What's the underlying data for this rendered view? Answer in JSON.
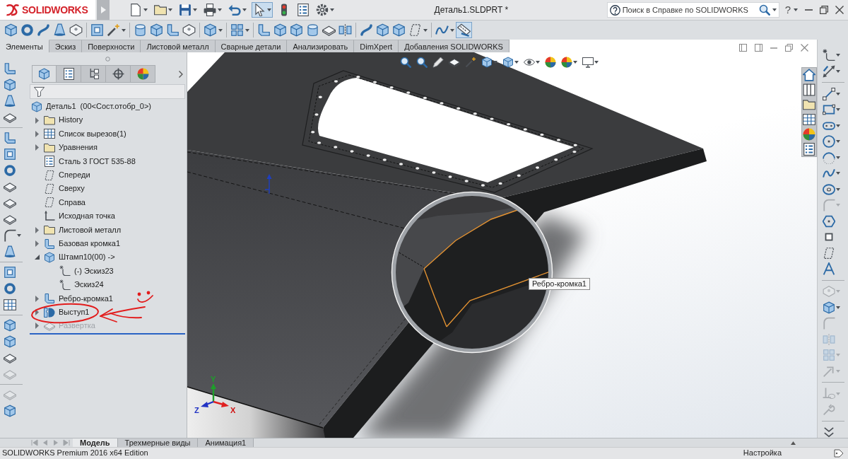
{
  "title_bar": {
    "logo": "SOLIDWORKS",
    "document": "Деталь1.SLDPRT *",
    "search": {
      "placeholder": "Поиск в Справке по SOLIDWORKS"
    },
    "help": "?"
  },
  "quick_toolbar": [
    {
      "kind": "page",
      "menu": true,
      "pressed": false
    },
    {
      "kind": "folder",
      "menu": true,
      "pressed": false
    },
    {
      "kind": "disk",
      "menu": true,
      "pressed": false
    },
    {
      "kind": "printer",
      "menu": true,
      "pressed": false
    },
    {
      "kind": "undo",
      "menu": true,
      "pressed": false
    },
    {
      "kind": "pointer",
      "menu": true,
      "pressed": true
    },
    {
      "kind": "traffic-light",
      "menu": false,
      "pressed": false
    },
    {
      "kind": "list",
      "menu": false,
      "pressed": false
    },
    {
      "kind": "gear",
      "menu": true,
      "pressed": false
    }
  ],
  "command_toolbar": [
    [
      {
        "kind": "cube",
        "menu": false,
        "pressed": false
      },
      {
        "kind": "ring",
        "menu": false,
        "pressed": false
      },
      {
        "kind": "s-curve",
        "menu": false,
        "pressed": false
      },
      {
        "kind": "cone",
        "menu": false,
        "pressed": false
      },
      {
        "kind": "block",
        "menu": false,
        "pressed": false
      }
    ],
    [
      {
        "kind": "frame",
        "menu": false,
        "pressed": false
      },
      {
        "kind": "wand",
        "menu": true,
        "pressed": false
      }
    ],
    [
      {
        "kind": "cylinder",
        "menu": false,
        "pressed": false
      },
      {
        "kind": "cube",
        "menu": false,
        "pressed": false
      },
      {
        "kind": "bracket",
        "menu": false,
        "pressed": false
      },
      {
        "kind": "block",
        "menu": false,
        "pressed": false
      }
    ],
    [
      {
        "kind": "cube",
        "menu": true,
        "pressed": false
      }
    ],
    [
      {
        "kind": "pattern",
        "menu": true,
        "pressed": false
      }
    ],
    [
      {
        "kind": "bracket",
        "menu": false,
        "pressed": false
      },
      {
        "kind": "cube",
        "menu": false,
        "pressed": false
      },
      {
        "kind": "cube",
        "menu": false,
        "pressed": false
      },
      {
        "kind": "cylinder",
        "menu": false,
        "pressed": false
      },
      {
        "kind": "plate",
        "menu": false,
        "pressed": false
      },
      {
        "kind": "mirror",
        "menu": false,
        "pressed": false
      }
    ],
    [
      {
        "kind": "s-curve",
        "menu": false,
        "pressed": false
      },
      {
        "kind": "cube",
        "menu": false,
        "pressed": false
      },
      {
        "kind": "cube",
        "menu": false,
        "pressed": false
      },
      {
        "kind": "plane",
        "menu": true,
        "pressed": false
      }
    ],
    [
      {
        "kind": "spline",
        "menu": true,
        "pressed": false
      },
      {
        "kind": "ruler",
        "menu": false,
        "pressed": true
      }
    ]
  ],
  "command_tabs": [
    {
      "label": "Элементы",
      "selected": true
    },
    {
      "label": "Эскиз",
      "selected": false
    },
    {
      "label": "Поверхности",
      "selected": false
    },
    {
      "label": "Листовой металл",
      "selected": false
    },
    {
      "label": "Сварные детали",
      "selected": false
    },
    {
      "label": "Анализировать",
      "selected": false
    },
    {
      "label": "DimXpert",
      "selected": false
    },
    {
      "label": "Добавления SOLIDWORKS",
      "selected": false
    }
  ],
  "feature_toolbar": [
    [
      {
        "kind": "bracket",
        "menu": false,
        "disabled": false
      },
      {
        "kind": "cube",
        "menu": false,
        "disabled": false
      },
      {
        "kind": "cone",
        "menu": false,
        "disabled": false
      },
      {
        "kind": "plate",
        "menu": false,
        "disabled": false
      }
    ],
    [
      {
        "kind": "bracket",
        "menu": false,
        "disabled": false
      },
      {
        "kind": "frame",
        "menu": false,
        "disabled": false
      },
      {
        "kind": "ring",
        "menu": false,
        "disabled": false
      },
      {
        "kind": "plate",
        "menu": false,
        "disabled": false
      },
      {
        "kind": "plate",
        "menu": false,
        "disabled": false
      },
      {
        "kind": "plate",
        "menu": false,
        "disabled": false
      },
      {
        "kind": "corner",
        "menu": true,
        "disabled": false
      },
      {
        "kind": "cone",
        "menu": false,
        "disabled": false
      }
    ],
    [
      {
        "kind": "frame",
        "menu": false,
        "disabled": false
      },
      {
        "kind": "ring",
        "menu": false,
        "disabled": false
      },
      {
        "kind": "table",
        "menu": false,
        "disabled": false
      }
    ],
    [
      {
        "kind": "cube",
        "menu": false,
        "disabled": false
      },
      {
        "kind": "cube",
        "menu": false,
        "disabled": false
      },
      {
        "kind": "plate",
        "menu": false,
        "disabled": false
      },
      {
        "kind": "plate",
        "menu": false,
        "disabled": true
      }
    ],
    [
      {
        "kind": "plate",
        "menu": false,
        "disabled": true
      },
      {
        "kind": "cube",
        "menu": false,
        "disabled": false
      }
    ]
  ],
  "panel": {
    "tabs": [
      {
        "kind": "cube",
        "selected": true
      },
      {
        "kind": "list",
        "selected": false
      },
      {
        "kind": "tree",
        "selected": false
      },
      {
        "kind": "crosshair",
        "selected": false
      },
      {
        "kind": "color-ball",
        "selected": false
      }
    ]
  },
  "tree": {
    "label": "Деталь1  (00<Сост.отобр_0>)",
    "kind": "cube",
    "disabled": false,
    "children": [
      {
        "label": "History",
        "kind": "folder",
        "expandable": true,
        "expanded": false,
        "disabled": false
      },
      {
        "label": "Список вырезов(1)",
        "kind": "table",
        "expandable": true,
        "expanded": false,
        "disabled": false
      },
      {
        "label": "Уравнения",
        "kind": "folder",
        "expandable": true,
        "expanded": false,
        "disabled": false
      },
      {
        "label": "Сталь 3 ГОСТ 535-88",
        "kind": "list",
        "expandable": false,
        "expanded": false,
        "disabled": false
      },
      {
        "label": "Спереди",
        "kind": "plane",
        "expandable": false,
        "expanded": false,
        "disabled": false
      },
      {
        "label": "Сверху",
        "kind": "plane",
        "expandable": false,
        "expanded": false,
        "disabled": false
      },
      {
        "label": "Справа",
        "kind": "plane",
        "expandable": false,
        "expanded": false,
        "disabled": false
      },
      {
        "label": "Исходная точка",
        "kind": "axis",
        "expandable": false,
        "expanded": false,
        "disabled": false
      },
      {
        "label": "Листовой металл",
        "kind": "folder",
        "expandable": true,
        "expanded": false,
        "disabled": false
      },
      {
        "label": "Базовая кромка1",
        "kind": "bracket",
        "expandable": true,
        "expanded": false,
        "disabled": false
      },
      {
        "label": "Штамп10(00) ->",
        "kind": "cube",
        "expandable": true,
        "expanded": true,
        "disabled": false,
        "children": [
          {
            "label": "(-) Эскиз23",
            "kind": "sketch",
            "expandable": false,
            "expanded": false,
            "disabled": false
          },
          {
            "label": "Эскиз24",
            "kind": "sketch",
            "expandable": false,
            "expanded": false,
            "disabled": false
          }
        ]
      },
      {
        "label": "Ребро-кромка1",
        "kind": "bracket",
        "expandable": true,
        "expanded": false,
        "disabled": false
      },
      {
        "label": "Выступ1",
        "kind": "d-shape",
        "expandable": true,
        "expanded": false,
        "disabled": false
      },
      {
        "label": "Развертка",
        "kind": "plate",
        "expandable": true,
        "expanded": false,
        "disabled": true
      }
    ]
  },
  "viewport": {
    "heads_up_toolbar": [
      {
        "kind": "magnifier",
        "menu": false
      },
      {
        "kind": "magnifier",
        "menu": false
      },
      {
        "kind": "pencil",
        "menu": false
      },
      {
        "kind": "plate",
        "menu": false
      },
      {
        "kind": "wand",
        "menu": false
      },
      {
        "kind": "cube",
        "menu": true
      },
      {
        "kind": "cube",
        "menu": true
      },
      {
        "kind": "eye",
        "menu": true
      },
      {
        "kind": "color-ball",
        "menu": false
      },
      {
        "kind": "color-ball",
        "menu": true
      },
      {
        "kind": "monitor",
        "menu": true
      }
    ],
    "view_pane": [
      {
        "kind": "home"
      },
      {
        "kind": "books"
      },
      {
        "kind": "folder"
      },
      {
        "kind": "table"
      },
      {
        "kind": "color-ball"
      },
      {
        "kind": "list"
      }
    ],
    "tooltip": "Ребро-кромка1",
    "triad": {
      "x": "X",
      "y": "Y",
      "z": "Z"
    }
  },
  "sketch_toolbar": [
    [
      {
        "kind": "sketch",
        "menu": true,
        "disabled": false
      },
      {
        "kind": "dimension",
        "menu": true,
        "disabled": false
      }
    ],
    [
      {
        "kind": "line",
        "menu": true,
        "disabled": false
      },
      {
        "kind": "rectangle",
        "menu": true,
        "disabled": false
      },
      {
        "kind": "slot",
        "menu": true,
        "disabled": false
      },
      {
        "kind": "circle",
        "menu": true,
        "disabled": false
      },
      {
        "kind": "arc",
        "menu": true,
        "disabled": false
      },
      {
        "kind": "spline",
        "menu": true,
        "disabled": false
      },
      {
        "kind": "ellipse",
        "menu": true,
        "disabled": false
      },
      {
        "kind": "corner",
        "menu": true,
        "disabled": true
      },
      {
        "kind": "polygon",
        "menu": false,
        "disabled": false
      },
      {
        "kind": "point",
        "menu": false,
        "disabled": false
      },
      {
        "kind": "plane",
        "menu": false,
        "disabled": false
      },
      {
        "kind": "letter-a",
        "menu": false,
        "disabled": false
      }
    ],
    [
      {
        "kind": "block",
        "menu": true,
        "disabled": true
      },
      {
        "kind": "cube",
        "menu": true,
        "disabled": false
      },
      {
        "kind": "corner",
        "menu": false,
        "disabled": true
      },
      {
        "kind": "mirror",
        "menu": false,
        "disabled": true
      },
      {
        "kind": "pattern",
        "menu": true,
        "disabled": true
      },
      {
        "kind": "move",
        "menu": true,
        "disabled": true
      }
    ],
    [
      {
        "kind": "relation",
        "menu": true,
        "disabled": true
      },
      {
        "kind": "wrench",
        "menu": false,
        "disabled": true
      }
    ],
    [
      {
        "kind": "chevrons",
        "menu": false,
        "disabled": false
      }
    ]
  ],
  "bottom_tabs": [
    {
      "label": "Модель",
      "selected": true
    },
    {
      "label": "Трехмерные виды",
      "selected": false
    },
    {
      "label": "Анимация1",
      "selected": false
    }
  ],
  "status_bar": {
    "edition": "SOLIDWORKS Premium 2016 x64 Edition",
    "customize": "Настройка"
  }
}
